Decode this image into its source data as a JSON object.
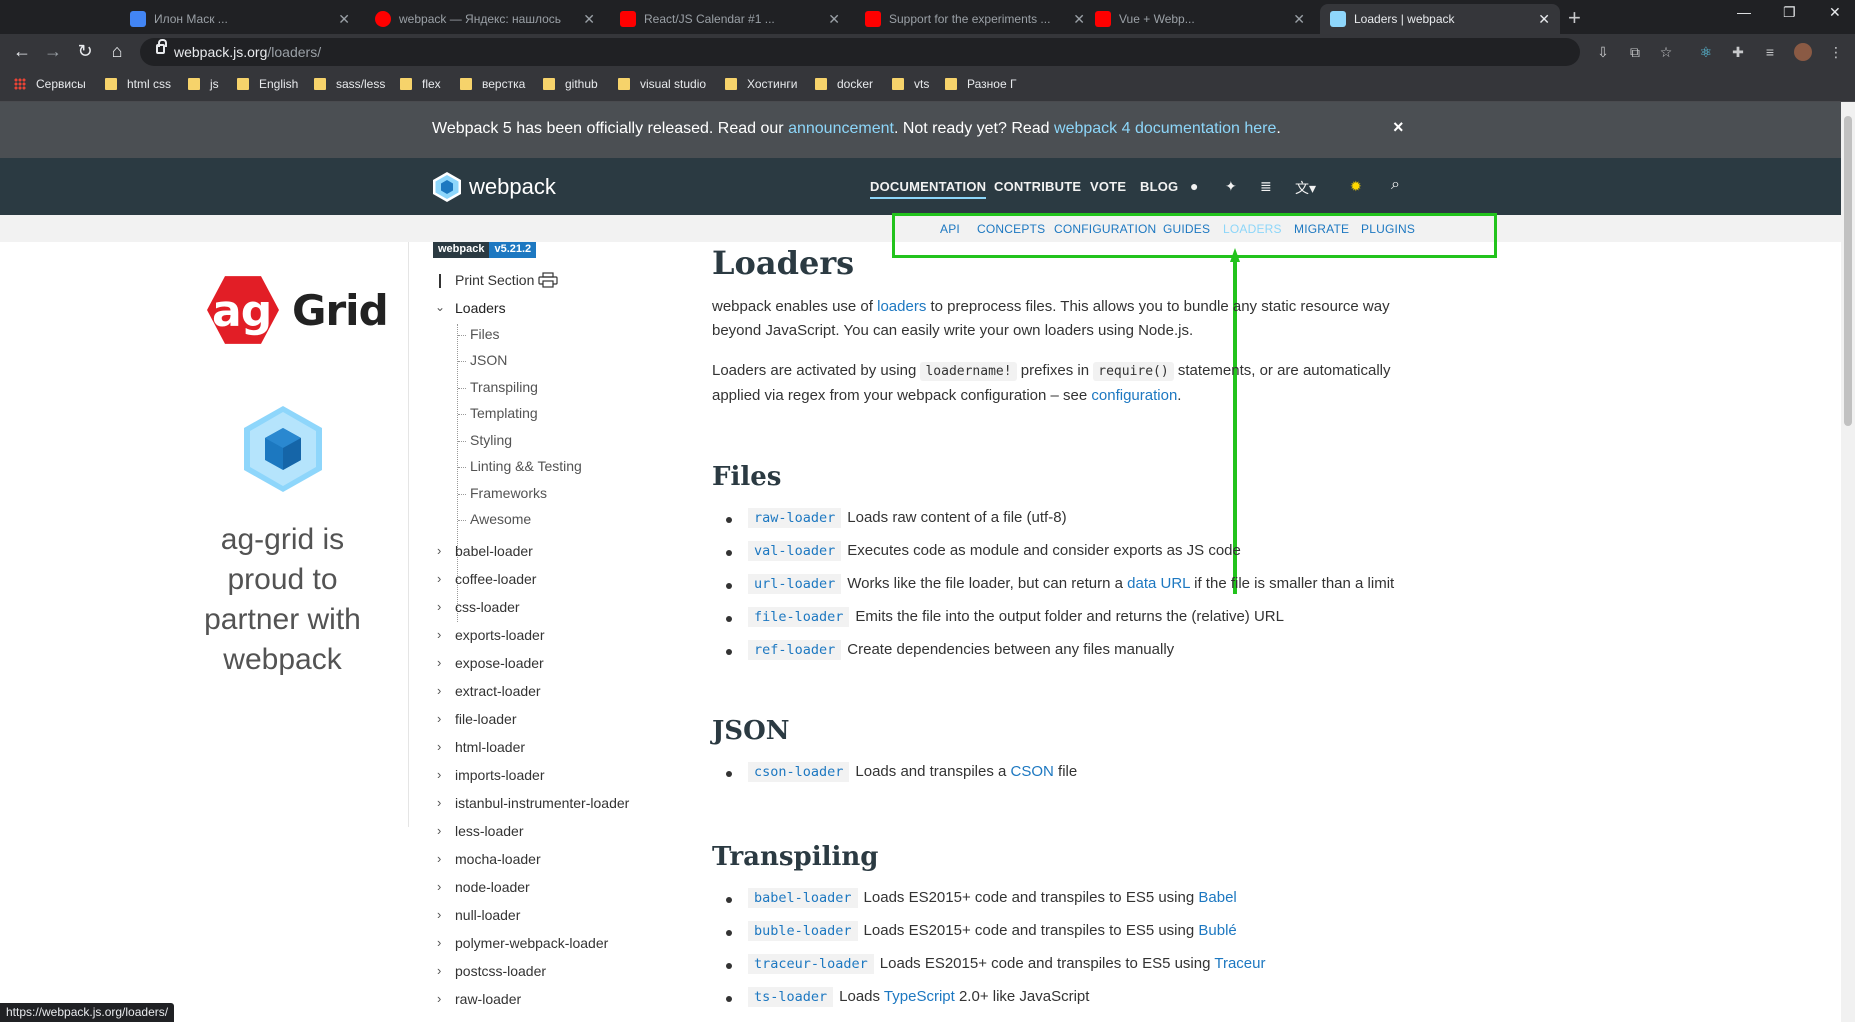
{
  "browser": {
    "tabs": [
      {
        "title": "Илон Маск ...",
        "favicon_color": "#4285f4"
      },
      {
        "title": "webpack — Яндекс: нашлось",
        "favicon_color": "#ff0000"
      },
      {
        "title": "React/JS Calendar #1 ...",
        "favicon_color": "#ff0000"
      },
      {
        "title": "Support for the experiments ...",
        "favicon_color": "#ff0000"
      },
      {
        "title": "Vue + Webp...",
        "favicon_color": "#ff0000"
      },
      {
        "title": "Loaders | webpack",
        "favicon_color": "#8ed6fb",
        "active": true
      }
    ],
    "new_tab_icon": "+",
    "url_host": "webpack.js.org",
    "url_path": "/loaders/",
    "bookmarks": [
      "Сервисы",
      "html css",
      "js",
      "English",
      "sass/less",
      "flex",
      "верстка",
      "github",
      "visual studio",
      "Хостинги",
      "docker",
      "vts",
      "Разное Г"
    ],
    "status_url": "https://webpack.js.org/loaders/"
  },
  "notice": {
    "pre": "Webpack 5 has been officially released. Read our ",
    "link1": "announcement",
    "mid": ". Not ready yet? Read ",
    "link2": "webpack 4 documentation here",
    "post": ".",
    "close": "×"
  },
  "header": {
    "logo_text": "webpack",
    "nav": [
      "DOCUMENTATION",
      "CONTRIBUTE",
      "VOTE",
      "BLOG"
    ],
    "icons": [
      "github-icon",
      "twitter-icon",
      "stackoverflow-icon",
      "language-icon",
      "theme-icon",
      "search-icon"
    ]
  },
  "subnav": [
    "API",
    "CONCEPTS",
    "CONFIGURATION",
    "GUIDES",
    "LOADERS",
    "MIGRATE",
    "PLUGINS"
  ],
  "accent": {
    "highlight": "#22c31c",
    "link": "#1d78c1",
    "active_sub": "#8dd6f9"
  },
  "partner": {
    "brand_ag": "ag",
    "brand_grid": "Grid",
    "text": "ag-grid is proud to partner with webpack"
  },
  "sidebar": {
    "version_label": "webpack",
    "version": "v5.21.2",
    "print": "Print Section",
    "section": "Loaders",
    "subsections": [
      "Files",
      "JSON",
      "Transpiling",
      "Templating",
      "Styling",
      "Linting && Testing",
      "Frameworks",
      "Awesome"
    ],
    "items": [
      "babel-loader",
      "coffee-loader",
      "css-loader",
      "exports-loader",
      "expose-loader",
      "extract-loader",
      "file-loader",
      "html-loader",
      "imports-loader",
      "istanbul-instrumenter-loader",
      "less-loader",
      "mocha-loader",
      "node-loader",
      "null-loader",
      "polymer-webpack-loader",
      "postcss-loader",
      "raw-loader"
    ]
  },
  "content": {
    "title": "Loaders",
    "intro1_a": "webpack enables use of ",
    "intro1_link": "loaders",
    "intro1_b": " to preprocess files. This allows you to bundle any static resource way beyond JavaScript. You can easily write your own loaders using Node.js.",
    "intro2_a": "Loaders are activated by using ",
    "intro2_code1": "loadername!",
    "intro2_b": " prefixes in ",
    "intro2_code2": "require()",
    "intro2_c": " statements, or are automatically applied via regex from your webpack configuration – see ",
    "intro2_link": "configuration",
    "intro2_d": ".",
    "files_title": "Files",
    "files": [
      {
        "code": "raw-loader",
        "text": "Loads raw content of a file (utf-8)"
      },
      {
        "code": "val-loader",
        "text": "Executes code as module and consider exports as JS code"
      },
      {
        "code": "url-loader",
        "text": "Works like the file loader, but can return a ",
        "link": "data URL",
        "after": " if the file is smaller than a limit"
      },
      {
        "code": "file-loader",
        "text": "Emits the file into the output folder and returns the (relative) URL"
      },
      {
        "code": "ref-loader",
        "text": "Create dependencies between any files manually"
      }
    ],
    "json_title": "JSON",
    "json": [
      {
        "code": "cson-loader",
        "text": "Loads and transpiles a ",
        "link": "CSON",
        "after": " file"
      }
    ],
    "transpiling_title": "Transpiling",
    "transpiling": [
      {
        "code": "babel-loader",
        "text": "Loads ES2015+ code and transpiles to ES5 using ",
        "link": "Babel",
        "after": ""
      },
      {
        "code": "buble-loader",
        "text": "Loads ES2015+ code and transpiles to ES5 using ",
        "link": "Bublé",
        "after": ""
      },
      {
        "code": "traceur-loader",
        "text": "Loads ES2015+ code and transpiles to ES5 using ",
        "link": "Traceur",
        "after": ""
      },
      {
        "code": "ts-loader",
        "text": "Loads ",
        "link": "TypeScript",
        "after": " 2.0+ like JavaScript"
      }
    ]
  }
}
